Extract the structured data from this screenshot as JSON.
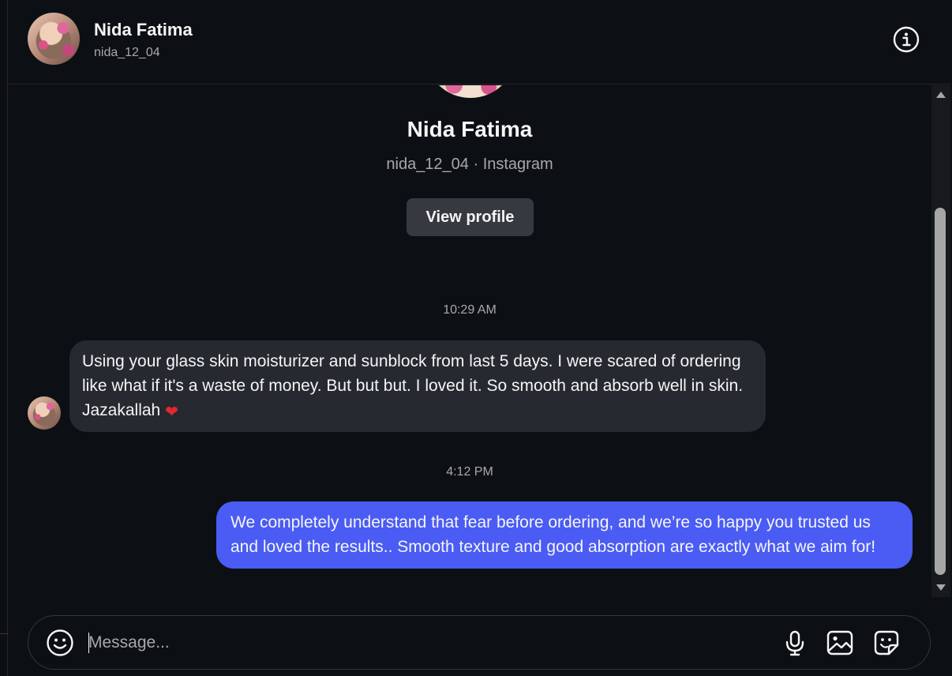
{
  "header": {
    "name": "Nida Fatima",
    "username": "nida_12_04",
    "info_icon": "info-icon"
  },
  "profile": {
    "name": "Nida Fatima",
    "subtitle": "nida_12_04 · Instagram",
    "view_profile_label": "View profile"
  },
  "messages": [
    {
      "timestamp": "10:29 AM",
      "direction": "incoming",
      "text": "Using your glass skin moisturizer and sunblock from last 5 days. I were scared of ordering like what if it's a waste of money. But but but. I loved it. So smooth and absorb well in skin. Jazakallah",
      "emoji": "❤"
    },
    {
      "timestamp": "4:12 PM",
      "direction": "outgoing",
      "text": "We completely understand that fear before ordering, and we’re so happy you trusted us and loved the results.. Smooth texture and good absorption are exactly what we aim for!"
    }
  ],
  "composer": {
    "placeholder": "Message...",
    "emoji_icon": "smiley-icon",
    "mic_icon": "microphone-icon",
    "image_icon": "image-icon",
    "sticker_icon": "sticker-icon"
  },
  "colors": {
    "background": "#0c1014",
    "incoming_bubble": "#262a30",
    "outgoing_bubble": "#4a5cf4",
    "secondary_text": "#a8a8a8",
    "button": "#363a40"
  }
}
